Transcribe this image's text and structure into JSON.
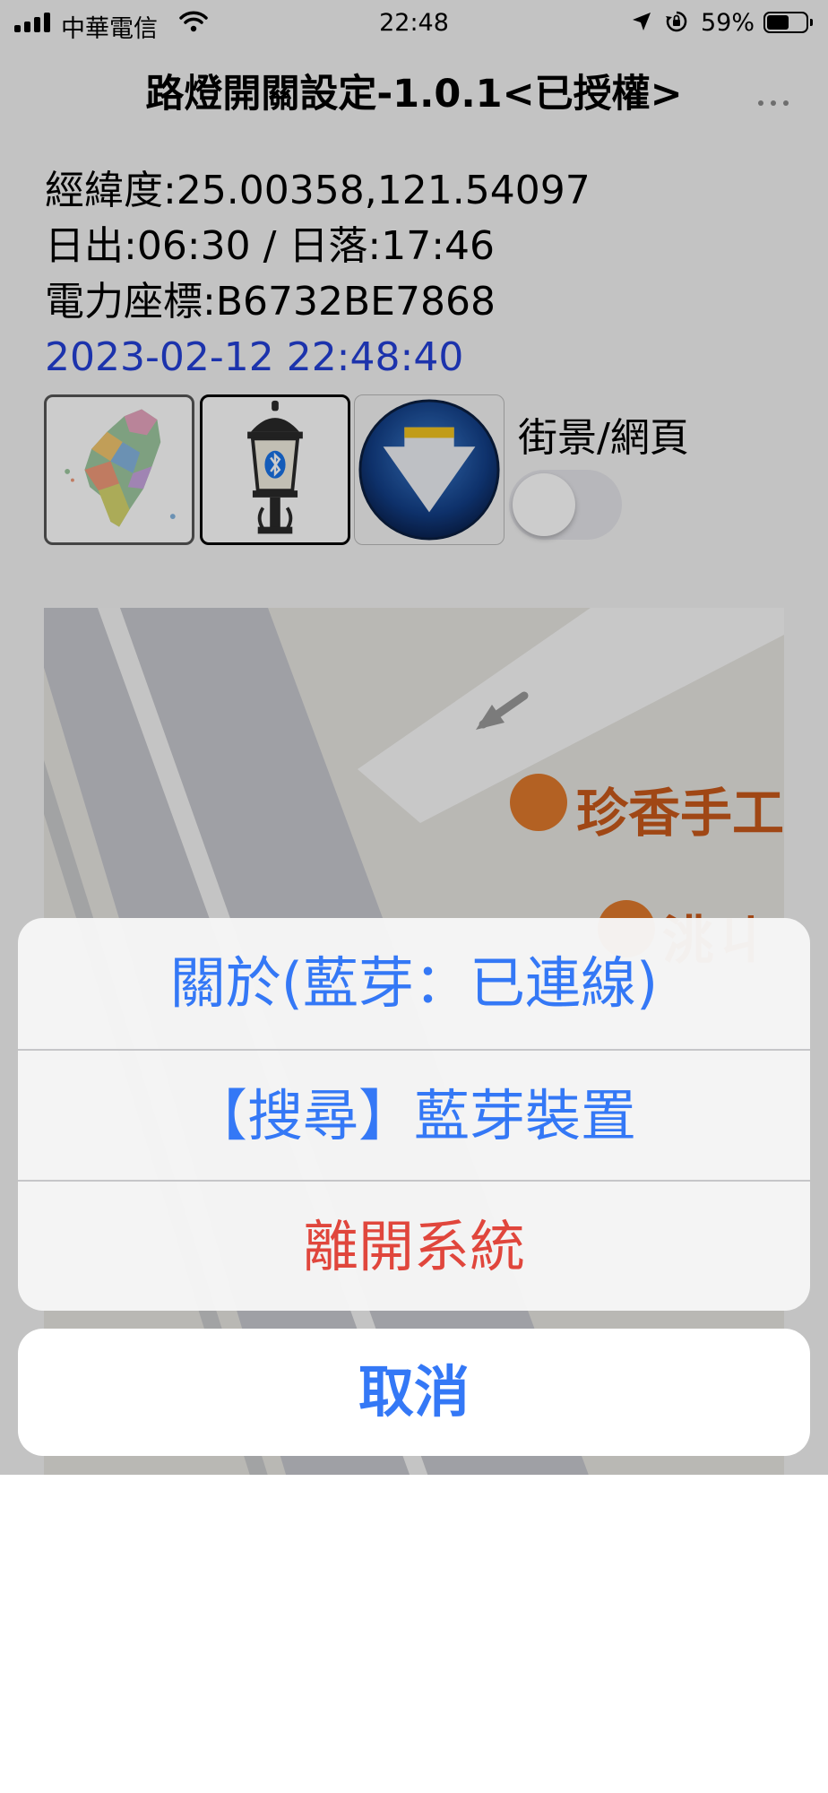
{
  "status_bar": {
    "carrier": "中華電信",
    "time": "22:48",
    "battery_percent": "59%",
    "battery_level": 0.59,
    "icons": [
      "signal-icon",
      "wifi-icon",
      "location-arrow-icon",
      "rotation-lock-icon",
      "battery-icon"
    ]
  },
  "nav": {
    "title": "路燈開關設定-1.0.1<已授權>",
    "more_icon": "ellipsis-icon"
  },
  "info": {
    "coordinates": "經緯度:25.00358,121.54097",
    "sun_times": "日出:06:30 / 日落:17:46",
    "power_coordinate": "電力座標:B6732BE7868",
    "datetime": "2023-02-12 22:48:40"
  },
  "tiles": {
    "map_icon": "taiwan-map-icon",
    "lamp_icon": "bluetooth-street-lamp-icon",
    "download_icon": "download-arrow-icon"
  },
  "street_view_toggle": {
    "label": "街景/網頁",
    "on": false
  },
  "map": {
    "poi_1": {
      "label": "珍香手工",
      "icon": "cupcake-icon"
    },
    "poi_2": {
      "label": "洮ㄐ",
      "icon": "place-icon"
    }
  },
  "action_sheet": {
    "actions": [
      {
        "label": "關於(藍芽：已連線)",
        "style": "default"
      },
      {
        "label": "【搜尋】藍芽裝置",
        "style": "default"
      },
      {
        "label": "離開系統",
        "style": "destructive"
      }
    ],
    "cancel_label": "取消"
  },
  "colors": {
    "action_blue": "#3478f6",
    "destructive_red": "#e0463c",
    "datetime_blue": "#2440d8",
    "poi_orange": "#c8591b"
  }
}
